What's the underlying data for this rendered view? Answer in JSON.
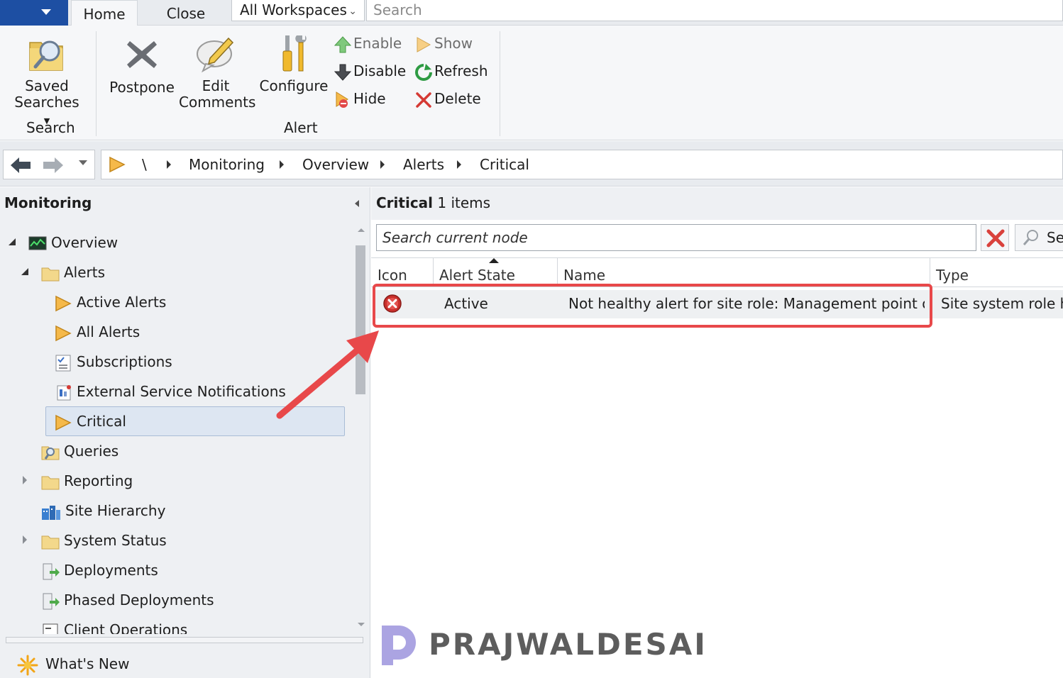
{
  "ribbon_tabs": {
    "home": "Home",
    "close": "Close"
  },
  "workspace_combo": "All Workspaces",
  "top_search_placeholder": "Search",
  "ribbon": {
    "saved_searches": [
      "Saved",
      "Searches"
    ],
    "postpone": "Postpone",
    "edit_comments": [
      "Edit",
      "Comments"
    ],
    "configure": "Configure",
    "enable": "Enable",
    "disable": "Disable",
    "hide": "Hide",
    "show": "Show",
    "refresh": "Refresh",
    "delete": "Delete",
    "group_search": "Search",
    "group_alert": "Alert"
  },
  "breadcrumb": {
    "root": "\\",
    "items": [
      "Monitoring",
      "Overview",
      "Alerts",
      "Critical"
    ]
  },
  "left_pane": {
    "title": "Monitoring",
    "tree": {
      "overview": "Overview",
      "alerts": "Alerts",
      "active_alerts": "Active Alerts",
      "all_alerts": "All Alerts",
      "subscriptions": "Subscriptions",
      "external_notifications": "External Service Notifications",
      "critical": "Critical",
      "queries": "Queries",
      "reporting": "Reporting",
      "site_hierarchy": "Site Hierarchy",
      "system_status": "System Status",
      "deployments": "Deployments",
      "phased_deployments": "Phased Deployments",
      "client_operations": "Client Operations"
    },
    "whats_new": "What's New"
  },
  "right_pane": {
    "title_bold": "Critical",
    "title_count": "1 items",
    "search_placeholder": "Search current node",
    "search_button": "Se",
    "columns": [
      "Icon",
      "Alert State",
      "Name",
      "Type"
    ],
    "rows": [
      {
        "state": "Active",
        "name": "Not healthy alert for site role: Management point on...",
        "type": "Site system role he"
      }
    ]
  },
  "watermark": "PRAJWALDESAI",
  "colors": {
    "accent": "#1d4fa3",
    "highlight": "#e8484a",
    "selection": "#dde6f2"
  }
}
